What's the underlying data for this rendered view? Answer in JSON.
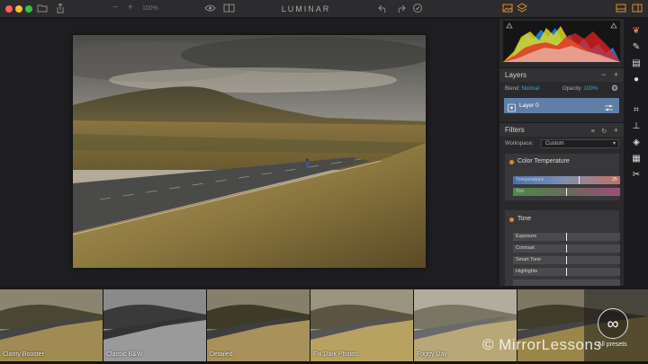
{
  "titlebar": {
    "app_name": "LUMINAR",
    "zoom_minus": "−",
    "zoom_plus": "+",
    "zoom_level": "100%"
  },
  "layers": {
    "title": "Layers",
    "minus": "−",
    "plus": "+",
    "blend_label": "Blend:",
    "blend_value": "Normal",
    "opacity_label": "Opacity:",
    "opacity_value": "100%",
    "layer_name": "Layer 0"
  },
  "filters": {
    "title": "Filters",
    "plus": "+",
    "workspace_label": "Workspace:",
    "workspace_value": "Custom",
    "color_temperature": {
      "title": "Color Temperature",
      "temperature_label": "Temperature",
      "temperature_value": "25",
      "tint_label": "Tint"
    },
    "tone": {
      "title": "Tone",
      "sliders": [
        "Exposure",
        "Contrast",
        "Smart Tone",
        "Highlights"
      ]
    }
  },
  "presets": {
    "items": [
      "Clarity Booster",
      "Classic B&W",
      "Detailed",
      "Fix Dark Photos",
      "Foggy Day"
    ],
    "all_presets_label": "All presets",
    "watermark": "© MirrorLessons"
  },
  "colors": {
    "accent": "#4aa0c8",
    "layer_highlight": "#5e7fa6",
    "filter_dot": "#e08a2a",
    "traffic_red": "#fe5f57",
    "traffic_yellow": "#febc2e",
    "traffic_green": "#28c840"
  }
}
